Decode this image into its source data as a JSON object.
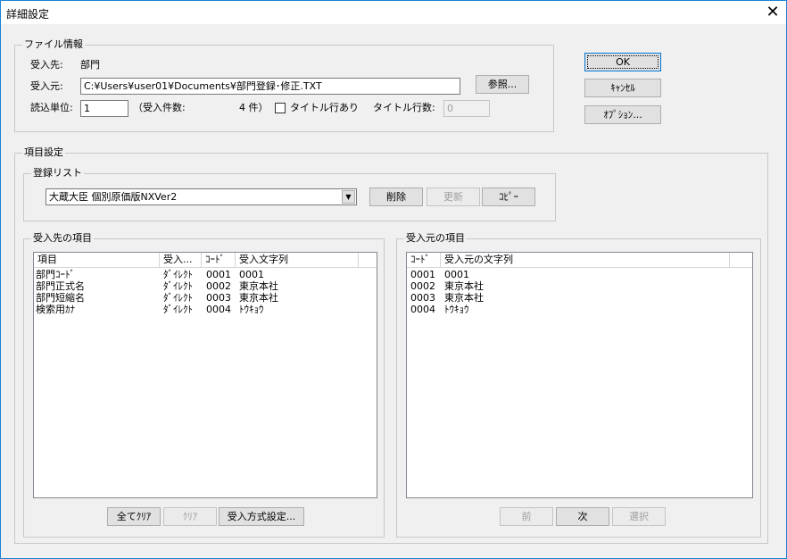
{
  "window": {
    "title": "詳細設定",
    "close": "✕"
  },
  "file_info": {
    "legend": "ファイル情報",
    "dest_label": "受入先:",
    "dest_value": "部門",
    "source_label": "受入元:",
    "source_path": "C:¥Users¥user01¥Documents¥部門登録･修正.TXT",
    "browse_button": "参照...",
    "unit_label": "読込単位:",
    "unit_value": "1",
    "count_label": "（受入件数:",
    "count_value": "4 件）",
    "title_row_label": "タイトル行あり",
    "title_row_checked": false,
    "title_rows_label": "タイトル行数:",
    "title_rows_value": "0"
  },
  "buttons": {
    "ok": "OK",
    "cancel": "ｷｬﾝｾﾙ",
    "options": "ｵﾌﾟｼｮﾝ..."
  },
  "item_settings": {
    "legend": "項目設定",
    "registration": {
      "legend": "登録リスト",
      "selected": "大蔵大臣 個別原価版NXVer2",
      "delete": "削除",
      "update": "更新",
      "copy": "ｺﾋﾟｰ"
    },
    "dest_items": {
      "legend": "受入先の項目",
      "columns": [
        "項目",
        "受入...",
        "ｺｰﾄﾞ",
        "受入文字列"
      ],
      "rows": [
        [
          "部門ｺｰﾄﾞ",
          "ﾀﾞｲﾚｸﾄ",
          "0001",
          "0001"
        ],
        [
          "部門正式名",
          "ﾀﾞｲﾚｸﾄ",
          "0002",
          "東京本社"
        ],
        [
          "部門短縮名",
          "ﾀﾞｲﾚｸﾄ",
          "0003",
          "東京本社"
        ],
        [
          "検索用ｶﾅ",
          "ﾀﾞｲﾚｸﾄ",
          "0004",
          "ﾄｳｷｮｳ"
        ]
      ],
      "clear_all": "全てｸﾘｱ",
      "clear": "ｸﾘｱ",
      "method": "受入方式設定..."
    },
    "source_items": {
      "legend": "受入元の項目",
      "columns": [
        "ｺｰﾄﾞ",
        "受入元の文字列"
      ],
      "rows": [
        [
          "0001",
          "0001"
        ],
        [
          "0002",
          "東京本社"
        ],
        [
          "0003",
          "東京本社"
        ],
        [
          "0004",
          "ﾄｳｷｮｳ"
        ]
      ],
      "prev": "前",
      "next": "次",
      "select": "選択"
    }
  }
}
